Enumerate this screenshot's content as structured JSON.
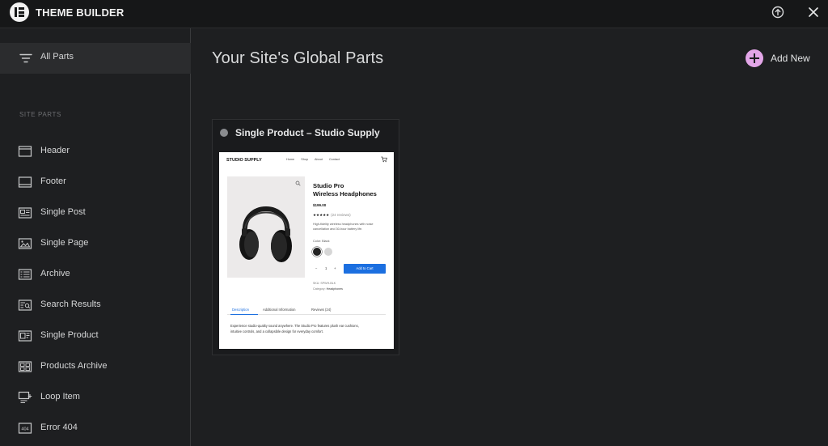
{
  "topbar": {
    "title": "THEME BUILDER",
    "help_icon": "upload-circle-icon",
    "close_icon": "close-icon"
  },
  "sidebar": {
    "all_parts_label": "All Parts",
    "section_label": "SITE PARTS",
    "items": [
      {
        "label": "Header",
        "icon": "header-icon"
      },
      {
        "label": "Footer",
        "icon": "footer-icon"
      },
      {
        "label": "Single Post",
        "icon": "single-post-icon"
      },
      {
        "label": "Single Page",
        "icon": "single-page-icon"
      },
      {
        "label": "Archive",
        "icon": "archive-icon"
      },
      {
        "label": "Search Results",
        "icon": "search-results-icon"
      },
      {
        "label": "Single Product",
        "icon": "single-product-icon"
      },
      {
        "label": "Products Archive",
        "icon": "products-archive-icon"
      },
      {
        "label": "Loop Item",
        "icon": "loop-item-icon"
      },
      {
        "label": "Error 404",
        "icon": "error-404-icon"
      }
    ]
  },
  "main": {
    "title": "Your Site's Global Parts",
    "add_new_label": "Add New",
    "accent_color": "#e3a6e8"
  },
  "card": {
    "title": "Single Product – Studio Supply",
    "preview": {
      "brand": "STUDIO SUPPLY",
      "nav": [
        "Home",
        "Shop",
        "About",
        "Contact"
      ],
      "product_name_line1": "Studio Pro",
      "product_name_line2": "Wireless Headphones",
      "price": "$199.00",
      "stars": "★★★★★",
      "reviews": "(24 reviews)",
      "short_desc": "High-fidelity wireless headphones with noise cancellation and 30-hour battery life.",
      "color_label": "Color: Black",
      "qty_minus": "−",
      "qty_value": "1",
      "qty_plus": "+",
      "add_to_cart": "Add to Cart",
      "sku": "SKU: SPWH-BLK",
      "category_label": "Category:",
      "category_value": "Headphones",
      "tabs": [
        "Description",
        "Additional Information",
        "Reviews (24)"
      ],
      "body": "Experience studio-quality sound anywhere. The Studio Pro features plush ear cushions, intuitive controls, and a collapsible design for everyday comfort."
    }
  }
}
